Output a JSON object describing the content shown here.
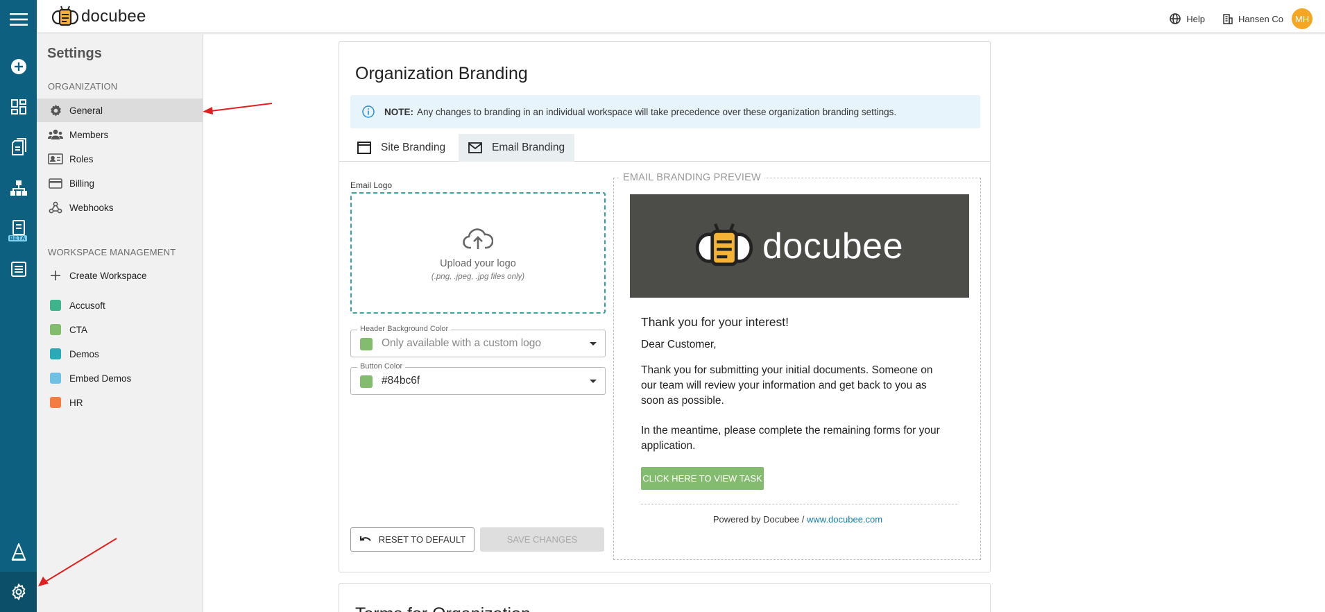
{
  "app": {
    "logo_text": "docubee"
  },
  "topbar": {
    "help_label": "Help",
    "org_name": "Hansen Co",
    "avatar_initials": "MH"
  },
  "rail": {
    "icons": [
      "menu-icon",
      "add-circle-icon",
      "dashboard-icon",
      "documents-icon",
      "workflow-icon",
      "forms-icon",
      "data-table-icon",
      "learning-icon",
      "gear-icon"
    ],
    "beta_label": "BETA"
  },
  "sidebar": {
    "title": "Settings",
    "org_heading": "ORGANIZATION",
    "org_items": [
      {
        "label": "General",
        "icon": "gear-icon",
        "active": true
      },
      {
        "label": "Members",
        "icon": "people-icon"
      },
      {
        "label": "Roles",
        "icon": "id-card-icon"
      },
      {
        "label": "Billing",
        "icon": "credit-card-icon"
      },
      {
        "label": "Webhooks",
        "icon": "webhook-icon"
      }
    ],
    "ws_heading": "WORKSPACE MANAGEMENT",
    "create_label": "Create Workspace",
    "workspaces": [
      {
        "label": "Accusoft",
        "color": "#3fb38c"
      },
      {
        "label": "CTA",
        "color": "#84bc6f"
      },
      {
        "label": "Demos",
        "color": "#2aaab6"
      },
      {
        "label": "Embed Demos",
        "color": "#6ec1e4"
      },
      {
        "label": "HR",
        "color": "#f47b42"
      }
    ]
  },
  "main": {
    "title": "Organization Branding",
    "note_bold": "NOTE:",
    "note_text": "Any changes to branding in an individual workspace will take precedence over these organization branding settings.",
    "tabs": [
      {
        "label": "Site Branding",
        "icon": "browser-window-icon"
      },
      {
        "label": "Email Branding",
        "icon": "envelope-icon",
        "active": true
      }
    ],
    "email_logo_label": "Email Logo",
    "upload_text": "Upload your logo",
    "upload_hint": "(.png, .jpeg, .jpg files only)",
    "header_bg": {
      "label": "Header Background Color",
      "placeholder": "Only available with a custom logo",
      "color": "#84bc6f"
    },
    "button_color": {
      "label": "Button Color",
      "value": "#84bc6f",
      "color": "#84bc6f"
    },
    "reset_label": "RESET TO DEFAULT",
    "save_label": "SAVE CHANGES",
    "next_card_title": "Terms for Organization"
  },
  "preview": {
    "legend": "EMAIL BRANDING PREVIEW",
    "logo_text": "docubee",
    "heading": "Thank you for your interest!",
    "greeting": "Dear Customer,",
    "para1": "Thank you for submitting your initial documents. Someone on our team will review your information and get back to you as soon as possible.",
    "para2": "In the meantime, please complete the remaining forms for your application.",
    "cta_label": "CLICK HERE TO VIEW TASK",
    "powered_prefix": "Powered by Docubee / ",
    "powered_link": "www.docubee.com"
  },
  "colors": {
    "rail": "#0e6080",
    "accent": "#84bc6f",
    "annotation_arrow": "#e02020"
  }
}
